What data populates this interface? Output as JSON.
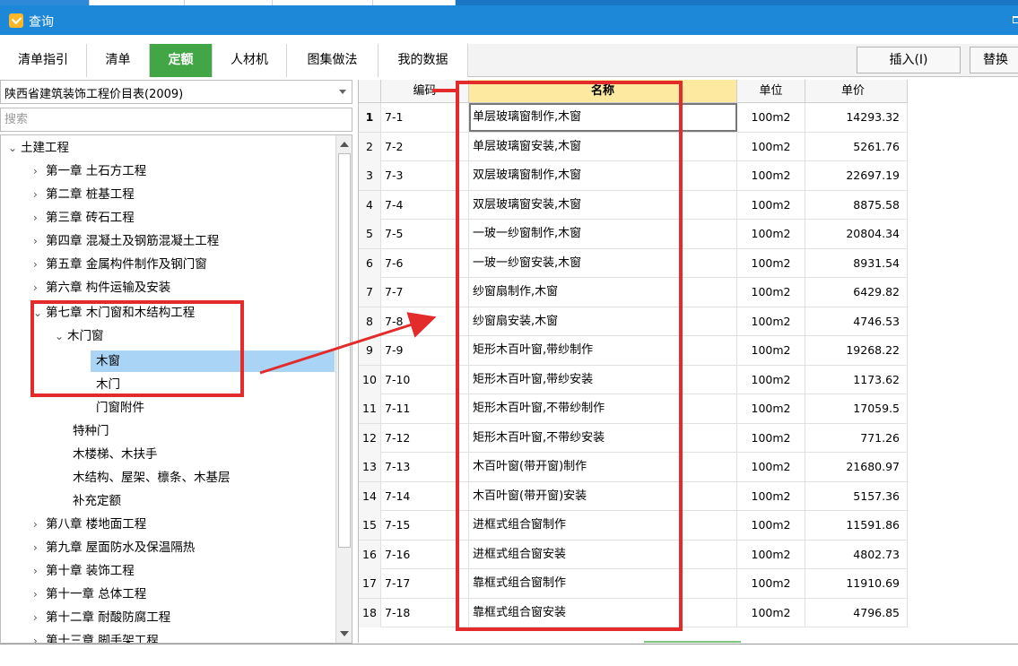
{
  "window": {
    "title": "查询"
  },
  "tabs": [
    {
      "label": "清单指引",
      "active": false
    },
    {
      "label": "清单",
      "active": false
    },
    {
      "label": "定额",
      "active": true
    },
    {
      "label": "人材机",
      "active": false
    },
    {
      "label": "图集做法",
      "active": false
    },
    {
      "label": "我的数据",
      "active": false
    }
  ],
  "toolbar": {
    "insert_label": "插入(I)",
    "replace_label": "替换"
  },
  "library": {
    "selected": "陕西省建筑装饰工程价目表(2009)"
  },
  "search": {
    "placeholder": "搜索"
  },
  "tree": {
    "root": "土建工程",
    "chapters_before": [
      "第一章 土石方工程",
      "第二章 桩基工程",
      "第三章 砖石工程",
      "第四章 混凝土及钢筋混凝土工程",
      "第五章 金属构件制作及钢门窗",
      "第六章 构件运输及安装"
    ],
    "chapter7": "第七章 木门窗和木结构工程",
    "wood_doors_windows": "木门窗",
    "leaf_items": [
      "木窗",
      "木门",
      "门窗附件"
    ],
    "chapter7_children": [
      "特种门",
      "木楼梯、木扶手",
      "木结构、屋架、檩条、木基层",
      "补充定额"
    ],
    "chapters_after": [
      "第八章 楼地面工程",
      "第九章 屋面防水及保温隔热",
      "第十章 装饰工程",
      "第十一章 总体工程",
      "第十二章 耐酸防腐工程",
      "第十三章 脚手架工程"
    ]
  },
  "table": {
    "columns": [
      "编码",
      "名称",
      "单位",
      "单价"
    ],
    "rows": [
      {
        "no": "1",
        "code": "7-1",
        "name": "单层玻璃窗制作,木窗",
        "unit": "100m2",
        "price": "14293.32"
      },
      {
        "no": "2",
        "code": "7-2",
        "name": "单层玻璃窗安装,木窗",
        "unit": "100m2",
        "price": "5261.76"
      },
      {
        "no": "3",
        "code": "7-3",
        "name": "双层玻璃窗制作,木窗",
        "unit": "100m2",
        "price": "22697.19"
      },
      {
        "no": "4",
        "code": "7-4",
        "name": "双层玻璃窗安装,木窗",
        "unit": "100m2",
        "price": "8875.58"
      },
      {
        "no": "5",
        "code": "7-5",
        "name": "一玻一纱窗制作,木窗",
        "unit": "100m2",
        "price": "20804.34"
      },
      {
        "no": "6",
        "code": "7-6",
        "name": "一玻一纱窗安装,木窗",
        "unit": "100m2",
        "price": "8931.54"
      },
      {
        "no": "7",
        "code": "7-7",
        "name": "纱窗扇制作,木窗",
        "unit": "100m2",
        "price": "6429.82"
      },
      {
        "no": "8",
        "code": "7-8",
        "name": "纱窗扇安装,木窗",
        "unit": "100m2",
        "price": "4746.53"
      },
      {
        "no": "9",
        "code": "7-9",
        "name": "矩形木百叶窗,带纱制作",
        "unit": "100m2",
        "price": "19268.22"
      },
      {
        "no": "10",
        "code": "7-10",
        "name": "矩形木百叶窗,带纱安装",
        "unit": "100m2",
        "price": "1173.62"
      },
      {
        "no": "11",
        "code": "7-11",
        "name": "矩形木百叶窗,不带纱制作",
        "unit": "100m2",
        "price": "17059.5"
      },
      {
        "no": "12",
        "code": "7-12",
        "name": "矩形木百叶窗,不带纱安装",
        "unit": "100m2",
        "price": "771.26"
      },
      {
        "no": "13",
        "code": "7-13",
        "name": "木百叶窗(带开窗)制作",
        "unit": "100m2",
        "price": "21680.97"
      },
      {
        "no": "14",
        "code": "7-14",
        "name": "木百叶窗(带开窗)安装",
        "unit": "100m2",
        "price": "5157.36"
      },
      {
        "no": "15",
        "code": "7-15",
        "name": "进框式组合窗制作",
        "unit": "100m2",
        "price": "11591.86"
      },
      {
        "no": "16",
        "code": "7-16",
        "name": "进框式组合窗安装",
        "unit": "100m2",
        "price": "4802.73"
      },
      {
        "no": "17",
        "code": "7-17",
        "name": "靠框式组合窗制作",
        "unit": "100m2",
        "price": "11910.69"
      },
      {
        "no": "18",
        "code": "7-18",
        "name": "靠框式组合窗安装",
        "unit": "100m2",
        "price": "4796.85"
      }
    ]
  },
  "colors": {
    "titlebar": "#1e88d8",
    "active_tab": "#42a546",
    "selected_tree": "#a9d4f5",
    "annotation": "#e32b2b",
    "header_selected": "#fdeaa0"
  }
}
